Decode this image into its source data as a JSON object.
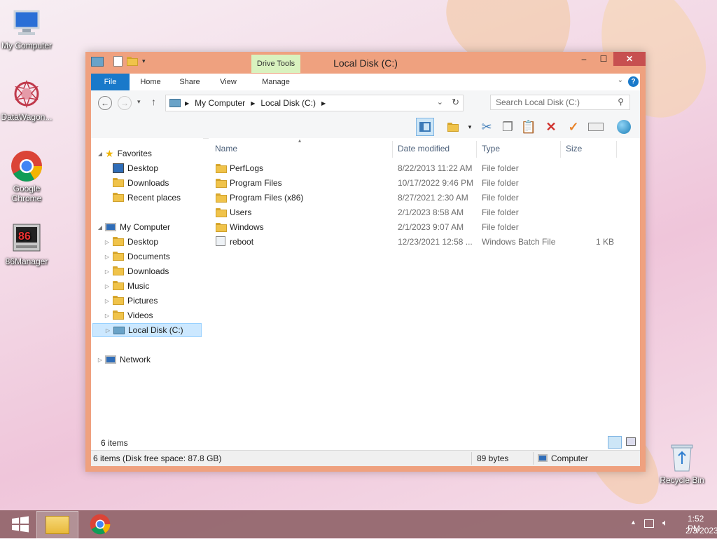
{
  "desktop": {
    "icons": [
      {
        "label": "My Computer",
        "icon": "computer-icon"
      },
      {
        "label": "DataWagon...",
        "icon": "datawagon-icon"
      },
      {
        "label": "Google Chrome",
        "icon": "chrome-icon"
      },
      {
        "label": "86Manager",
        "icon": "86manager-icon"
      },
      {
        "label": "Recycle Bin",
        "icon": "recycle-bin-icon"
      }
    ]
  },
  "window": {
    "title": "Local Disk (C:)",
    "context_tab": "Drive Tools",
    "tabs": [
      "File",
      "Home",
      "Share",
      "View",
      "Manage"
    ],
    "controls": {
      "minimize": "–",
      "maximize": "☐",
      "close": "✕"
    }
  },
  "address": {
    "crumbs": [
      "My Computer",
      "Local Disk (C:)"
    ],
    "search_placeholder": "Search Local Disk (C:)"
  },
  "nav": {
    "favorites": {
      "label": "Favorites",
      "items": [
        "Desktop",
        "Downloads",
        "Recent places"
      ]
    },
    "computer": {
      "label": "My Computer",
      "items": [
        "Desktop",
        "Documents",
        "Downloads",
        "Music",
        "Pictures",
        "Videos",
        "Local Disk (C:)"
      ]
    },
    "network": "Network"
  },
  "columns": {
    "name": "Name",
    "date": "Date modified",
    "type": "Type",
    "size": "Size"
  },
  "files": [
    {
      "name": "PerfLogs",
      "date": "8/22/2013 11:22 AM",
      "type": "File folder",
      "size": ""
    },
    {
      "name": "Program Files",
      "date": "10/17/2022 9:46 PM",
      "type": "File folder",
      "size": ""
    },
    {
      "name": "Program Files (x86)",
      "date": "8/27/2021 2:30 AM",
      "type": "File folder",
      "size": ""
    },
    {
      "name": "Users",
      "date": "2/1/2023 8:58 AM",
      "type": "File folder",
      "size": ""
    },
    {
      "name": "Windows",
      "date": "2/1/2023 9:07 AM",
      "type": "File folder",
      "size": ""
    },
    {
      "name": "reboot",
      "date": "12/23/2021 12:58 ...",
      "type": "Windows Batch File",
      "size": "1 KB"
    }
  ],
  "status": {
    "count": "6 items",
    "bar_left": "6 items (Disk free space: 87.8 GB)",
    "bar_mid": "89 bytes",
    "bar_right": "Computer"
  },
  "taskbar": {
    "time": "1:52 PM",
    "date": "2/3/2023"
  }
}
